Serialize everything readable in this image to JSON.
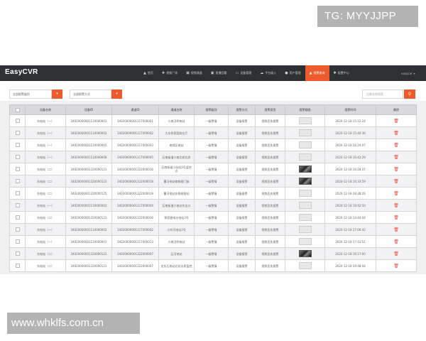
{
  "watermark_top": "TG: MYYJJPP",
  "watermark_bottom": "www.whklfs.com.cn",
  "app": {
    "title": "EasyCVR",
    "nav": [
      {
        "label": "首页",
        "icon": "home-icon",
        "glyph": "▲",
        "active": false
      },
      {
        "label": "视频广场",
        "icon": "grid-icon",
        "glyph": "✚",
        "active": false
      },
      {
        "label": "视频通道",
        "icon": "video-icon",
        "glyph": "▣",
        "active": false
      },
      {
        "label": "直播回看",
        "icon": "playback-icon",
        "glyph": "▣",
        "active": false
      },
      {
        "label": "设备管理",
        "icon": "device-icon",
        "glyph": "▭",
        "active": false
      },
      {
        "label": "平台级入",
        "icon": "cloud-icon",
        "glyph": "☁",
        "active": false
      },
      {
        "label": "用户管理",
        "icon": "user-icon",
        "glyph": "●",
        "active": false
      },
      {
        "label": "报警查询",
        "icon": "alarm-icon",
        "glyph": "▲",
        "active": true
      },
      {
        "label": "配置中心",
        "icon": "gear-icon",
        "glyph": "✱",
        "active": false
      }
    ],
    "user": {
      "name": "easycvr",
      "caret": "▾"
    }
  },
  "filters": {
    "alarm_level": "全部报警级别",
    "alarm_method": "全部报警方式",
    "dropdown_glyph": "▾",
    "search_placeholder": "设备名称搜索",
    "search_glyph": "⚲"
  },
  "table": {
    "columns": [
      "",
      "设备名称",
      "设备ID",
      "通道ID",
      "通道名称",
      "报警级别",
      "报警方式",
      "报警类型",
      "报警截图",
      "报警时间",
      "删除"
    ],
    "delete_glyph": "🗑",
    "rows": [
      {
        "device_name": "东电站（一）",
        "device_id": "34020000001110000001",
        "channel_id": "34020000001317000001",
        "channel_name": "小南河明电站",
        "level": "一级警情",
        "method": "设备报警",
        "type": "视频丢失报警",
        "snapshot": "light",
        "time": "2020-12-18 15:22:24"
      },
      {
        "device_name": "东电站（一）",
        "device_id": "34020000001110000003",
        "channel_id": "34020000001317000002",
        "channel_name": "大东桥家国务在厅",
        "level": "一级警情",
        "method": "设备报警",
        "type": "视频丢失报警",
        "snapshot": "light",
        "time": "2020-12-18 15:40:36"
      },
      {
        "device_name": "东电站（一）",
        "device_id": "34020000001110000005",
        "channel_id": "34020000001317000003",
        "channel_name": "南郊区电站",
        "level": "一级警情",
        "method": "设备报警",
        "type": "视频丢失报警",
        "snapshot": "light",
        "time": "2020-12-18 16:24:07"
      },
      {
        "device_name": "东电站（一）",
        "device_id": "34020000001110000008",
        "channel_id": "34020000001317000005",
        "channel_name": "石南街道小南北桥北岸",
        "level": "一级警情",
        "method": "设备报警",
        "type": "视频丢失报警",
        "snapshot": "light",
        "time": "2020-12-18 16:43:29"
      },
      {
        "device_name": "东电站（二）",
        "device_id": "34020000001320000121",
        "channel_id": "34020000001322000016",
        "channel_name": "石南街道小站站2号监控点",
        "level": "一级警情",
        "method": "设备报警",
        "type": "视频丢失报警",
        "snapshot": "dark",
        "time": "2020-12-18 16:28:37"
      },
      {
        "device_name": "东电站（二）",
        "device_id": "34020000001320000123",
        "channel_id": "34020000001322000018",
        "channel_name": "曹河电站南侧闸门前",
        "level": "一级警情",
        "method": "设备报警",
        "type": "视频丢失报警",
        "snapshot": "dark",
        "time": "2020-12-18 16:33:59"
      },
      {
        "device_name": "东电站（二）",
        "device_id": "34020000001320000125",
        "channel_id": "34020000001322000019",
        "channel_name": "曹河电站东侧闸前站",
        "level": "一级警情",
        "method": "设备报警",
        "type": "视频丢失报警",
        "snapshot": "light",
        "time": "2020-12-18 18:28:26"
      },
      {
        "device_name": "东电站（一）",
        "device_id": "34020000001110000003",
        "channel_id": "34020000001317000004",
        "channel_name": "石南街道小电站东出口",
        "level": "一级警情",
        "method": "设备报警",
        "type": "视频丢失报警",
        "snapshot": "light",
        "time": "2020-12-18 18:42:50"
      },
      {
        "device_name": "东电站（二）",
        "device_id": "34020000001320000121",
        "channel_id": "34020000001322000016",
        "channel_name": "翠家屋电水电站3号",
        "level": "一级警情",
        "method": "设备报警",
        "type": "视频丢失报警",
        "snapshot": "light",
        "time": "2020-12-18 14:44:04"
      },
      {
        "device_name": "东电站（一）",
        "device_id": "34020000001110000002",
        "channel_id": "34020000001317000002",
        "channel_name": "小东河电站2号",
        "level": "一级警情",
        "method": "设备报警",
        "type": "视频丢失报警",
        "snapshot": "light",
        "time": "2020-12-18 17:00:42"
      },
      {
        "device_name": "东电站（一）",
        "device_id": "34020000001110000001",
        "channel_id": "34020000001317000013",
        "channel_name": "小南河明电站",
        "level": "一级警情",
        "method": "设备报警",
        "type": "视频丢失报警",
        "snapshot": "light",
        "time": "2020-12-18 17:43:51"
      },
      {
        "device_name": "东电站（二）",
        "device_id": "34020000001320000123",
        "channel_id": "34020000001322000007",
        "channel_name": "石河电站",
        "level": "一级警情",
        "method": "设备报警",
        "type": "视频丢失报警",
        "snapshot": "dark",
        "time": "2020-12-18 16:17:00"
      },
      {
        "device_name": "东电站（二）",
        "device_id": "34020000001320000121",
        "channel_id": "34020000001322000007",
        "channel_name": "龙东石电站北坊水质监控",
        "level": "一级警情",
        "method": "设备报警",
        "type": "视频丢失报警",
        "snapshot": "light",
        "time": "2020-12-18 19:48:44"
      }
    ]
  }
}
